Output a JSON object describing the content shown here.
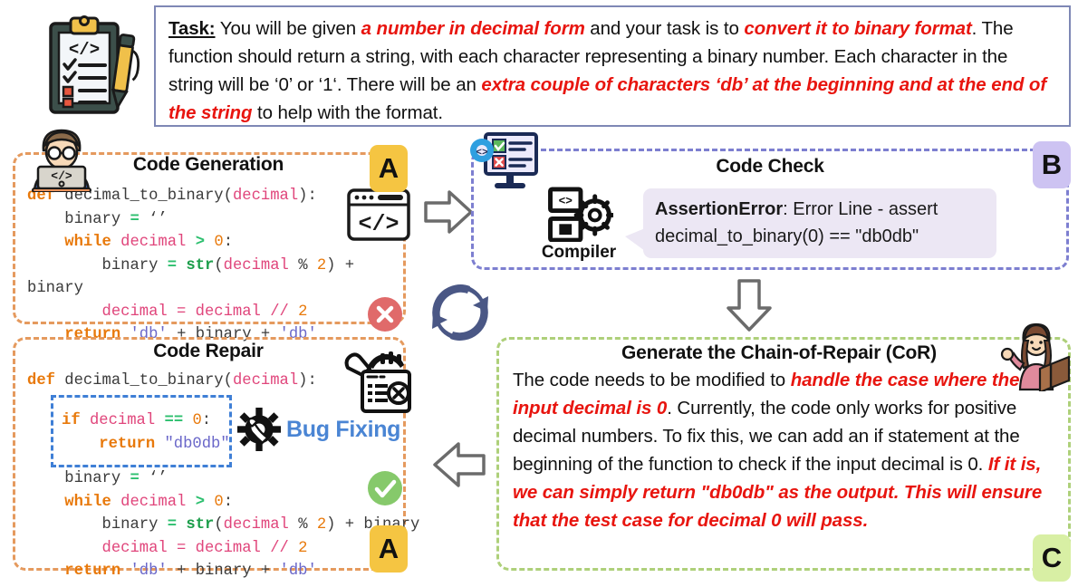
{
  "task": {
    "label": "Task:",
    "segments": [
      {
        "t": " You will be given ",
        "style": "normal"
      },
      {
        "t": "a number in decimal form",
        "style": "em"
      },
      {
        "t": " and your task is to ",
        "style": "normal"
      },
      {
        "t": "convert it to binary format",
        "style": "em"
      },
      {
        "t": ". The function should return a string, with each character representing a binary number. Each character in the string will be ‘0’ or ‘1‘. There will be an ",
        "style": "normal"
      },
      {
        "t": "extra couple of characters ‘db’ at the beginning and at the end of the string",
        "style": "em"
      },
      {
        "t": " to help with the format.",
        "style": "normal"
      }
    ],
    "icon": "clipboard-code-icon"
  },
  "panels": {
    "code_generation": {
      "title": "Code Generation",
      "badge": "A",
      "badge_color": "#f5c542",
      "border_color": "#e59a5e",
      "status_icon": "fail-circle-icon",
      "avatar_icon": "developer-laptop-icon",
      "side_icon": "code-window-icon",
      "code_lines": [
        [
          {
            "t": "def",
            "c": "kw"
          },
          {
            "t": " decimal_to_binary(",
            "c": "plain"
          },
          {
            "t": "decimal",
            "c": "var"
          },
          {
            "t": "):",
            "c": "plain"
          }
        ],
        [
          {
            "t": "    binary ",
            "c": "plain"
          },
          {
            "t": "=",
            "c": "op"
          },
          {
            "t": " ‘’",
            "c": "plain"
          }
        ],
        [
          {
            "t": "    ",
            "c": "plain"
          },
          {
            "t": "while",
            "c": "kw"
          },
          {
            "t": " ",
            "c": "plain"
          },
          {
            "t": "decimal",
            "c": "var"
          },
          {
            "t": " ",
            "c": "plain"
          },
          {
            "t": ">",
            "c": "op"
          },
          {
            "t": " ",
            "c": "plain"
          },
          {
            "t": "0",
            "c": "num"
          },
          {
            "t": ":",
            "c": "plain"
          }
        ],
        [
          {
            "t": "        binary ",
            "c": "plain"
          },
          {
            "t": "=",
            "c": "op"
          },
          {
            "t": " ",
            "c": "plain"
          },
          {
            "t": "str",
            "c": "fn"
          },
          {
            "t": "(",
            "c": "plain"
          },
          {
            "t": "decimal",
            "c": "var"
          },
          {
            "t": " ",
            "c": "plain"
          },
          {
            "t": "%",
            "c": "plain"
          },
          {
            "t": " ",
            "c": "plain"
          },
          {
            "t": "2",
            "c": "num"
          },
          {
            "t": ") +",
            "c": "plain"
          }
        ],
        [
          {
            "t": "binary",
            "c": "plain"
          }
        ],
        [
          {
            "t": "        ",
            "c": "plain"
          },
          {
            "t": "decimal",
            "c": "var"
          },
          {
            "t": " = ",
            "c": "var"
          },
          {
            "t": "decimal",
            "c": "var"
          },
          {
            "t": " ",
            "c": "plain"
          },
          {
            "t": "//",
            "c": "var"
          },
          {
            "t": " ",
            "c": "plain"
          },
          {
            "t": "2",
            "c": "num"
          }
        ],
        [
          {
            "t": "    ",
            "c": "plain"
          },
          {
            "t": "return",
            "c": "kw"
          },
          {
            "t": " ",
            "c": "plain"
          },
          {
            "t": "'db'",
            "c": "str"
          },
          {
            "t": " + binary + ",
            "c": "plain"
          },
          {
            "t": "'db'",
            "c": "str"
          }
        ]
      ]
    },
    "code_check": {
      "title": "Code Check",
      "badge": "B",
      "badge_color": "#cdc3f2",
      "border_color": "#7d7fd0",
      "monitor_icon": "monitor-check-cross-icon",
      "compiler_label": "Compiler",
      "compiler_icon": "compiler-gear-icon",
      "error": {
        "type": "AssertionError",
        "message": ": Error Line - assert decimal_to_binary(0) == \"db0db\""
      }
    },
    "code_repair": {
      "title": "Code Repair",
      "badge": "A",
      "badge_color": "#f5c542",
      "border_color": "#e59a5e",
      "status_icon": "pass-circle-icon",
      "tool_icon": "repair-toolbox-icon",
      "bug_fixing_label": "Bug Fixing",
      "bug_fixing_icon": "gear-wrench-icon",
      "bug_fixing_color": "#4a85d4",
      "head_lines": [
        [
          {
            "t": "def",
            "c": "kw"
          },
          {
            "t": " decimal_to_binary(",
            "c": "plain"
          },
          {
            "t": "decimal",
            "c": "var"
          },
          {
            "t": "):",
            "c": "plain"
          }
        ]
      ],
      "fix_lines": [
        [
          {
            "t": "if",
            "c": "kw"
          },
          {
            "t": " ",
            "c": "plain"
          },
          {
            "t": "decimal",
            "c": "var"
          },
          {
            "t": " ",
            "c": "plain"
          },
          {
            "t": "==",
            "c": "op"
          },
          {
            "t": " ",
            "c": "plain"
          },
          {
            "t": "0",
            "c": "num"
          },
          {
            "t": ":",
            "c": "plain"
          }
        ],
        [
          {
            "t": "    ",
            "c": "plain"
          },
          {
            "t": "return",
            "c": "kw"
          },
          {
            "t": " ",
            "c": "plain"
          },
          {
            "t": "\"db0db\"",
            "c": "str"
          }
        ]
      ],
      "tail_lines": [
        [
          {
            "t": "    binary ",
            "c": "plain"
          },
          {
            "t": "=",
            "c": "op"
          },
          {
            "t": " ‘’",
            "c": "plain"
          }
        ],
        [
          {
            "t": "    ",
            "c": "plain"
          },
          {
            "t": "while",
            "c": "kw"
          },
          {
            "t": " ",
            "c": "plain"
          },
          {
            "t": "decimal",
            "c": "var"
          },
          {
            "t": " ",
            "c": "plain"
          },
          {
            "t": ">",
            "c": "op"
          },
          {
            "t": " ",
            "c": "plain"
          },
          {
            "t": "0",
            "c": "num"
          },
          {
            "t": ":",
            "c": "plain"
          }
        ],
        [
          {
            "t": "        binary ",
            "c": "plain"
          },
          {
            "t": "=",
            "c": "op"
          },
          {
            "t": " ",
            "c": "plain"
          },
          {
            "t": "str",
            "c": "fn"
          },
          {
            "t": "(",
            "c": "plain"
          },
          {
            "t": "decimal",
            "c": "var"
          },
          {
            "t": " ",
            "c": "plain"
          },
          {
            "t": "%",
            "c": "plain"
          },
          {
            "t": " ",
            "c": "plain"
          },
          {
            "t": "2",
            "c": "num"
          },
          {
            "t": ") + binary",
            "c": "plain"
          }
        ],
        [
          {
            "t": "        ",
            "c": "plain"
          },
          {
            "t": "decimal",
            "c": "var"
          },
          {
            "t": " = ",
            "c": "var"
          },
          {
            "t": "decimal",
            "c": "var"
          },
          {
            "t": " ",
            "c": "plain"
          },
          {
            "t": "//",
            "c": "var"
          },
          {
            "t": " ",
            "c": "plain"
          },
          {
            "t": "2",
            "c": "num"
          }
        ],
        [
          {
            "t": "    ",
            "c": "plain"
          },
          {
            "t": "return",
            "c": "kw"
          },
          {
            "t": " ",
            "c": "plain"
          },
          {
            "t": "'db'",
            "c": "str"
          },
          {
            "t": " + binary + ",
            "c": "plain"
          },
          {
            "t": "'db'",
            "c": "str"
          }
        ]
      ]
    },
    "chain_of_repair": {
      "title": "Generate the Chain-of-Repair (CoR)",
      "badge": "C",
      "badge_color": "#d8efa4",
      "border_color": "#aed07a",
      "avatar_icon": "woman-reading-book-icon",
      "segments": [
        {
          "t": "The code needs to be modified to ",
          "style": "normal"
        },
        {
          "t": "handle the case where the input decimal is 0",
          "style": "em"
        },
        {
          "t": ". Currently, the code only works for positive decimal numbers. To fix this, we can add an if statement at the beginning of the function to check if the input decimal is 0. ",
          "style": "normal"
        },
        {
          "t": "If it is, we can simply return \"db0db\" as the output. This will ensure that the test case for decimal 0 will pass.",
          "style": "em"
        }
      ]
    }
  },
  "flow": {
    "arrow_right": "arrow-right-icon",
    "arrow_down": "arrow-down-icon",
    "arrow_left": "arrow-left-icon",
    "cycle": "refresh-cycle-icon"
  }
}
